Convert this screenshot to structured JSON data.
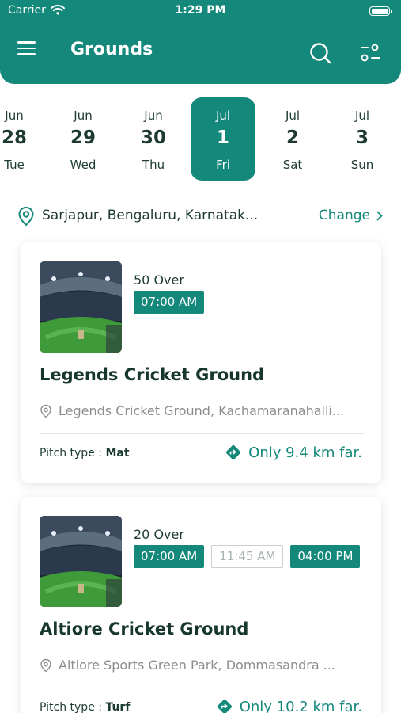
{
  "status": {
    "carrier": "Carrier",
    "time": "1:29 PM"
  },
  "header": {
    "title": "Grounds"
  },
  "dates": [
    {
      "month": "Jun",
      "day": "28",
      "weekday": "Tue"
    },
    {
      "month": "Jun",
      "day": "29",
      "weekday": "Wed"
    },
    {
      "month": "Jun",
      "day": "30",
      "weekday": "Thu"
    },
    {
      "month": "Jul",
      "day": "1",
      "weekday": "Fri",
      "active": true
    },
    {
      "month": "Jul",
      "day": "2",
      "weekday": "Sat"
    },
    {
      "month": "Jul",
      "day": "3",
      "weekday": "Sun"
    }
  ],
  "location": {
    "text": "Sarjapur, Bengaluru, Karnatak...",
    "change_label": "Change"
  },
  "grounds": [
    {
      "overs": "50 Over",
      "slots": [
        {
          "label": "07:00 AM",
          "available": true
        }
      ],
      "name": "Legends Cricket Ground",
      "address": "Legends Cricket Ground, Kachamaranahalli...",
      "pitch_label": "Pitch type : ",
      "pitch_type": "Mat",
      "distance": "Only 9.4 km far."
    },
    {
      "overs": "20 Over",
      "slots": [
        {
          "label": "07:00 AM",
          "available": true
        },
        {
          "label": "11:45 AM",
          "available": false
        },
        {
          "label": "04:00 PM",
          "available": true
        }
      ],
      "name": "Altiore Cricket Ground",
      "address": "Altiore Sports Green Park, Dommasandra ...",
      "pitch_label": "Pitch type : ",
      "pitch_type": "Turf",
      "distance": "Only 10.2 km far."
    }
  ],
  "colors": {
    "primary": "#14887a",
    "text_dark": "#1d3b2f",
    "muted": "#8a8f8d"
  }
}
